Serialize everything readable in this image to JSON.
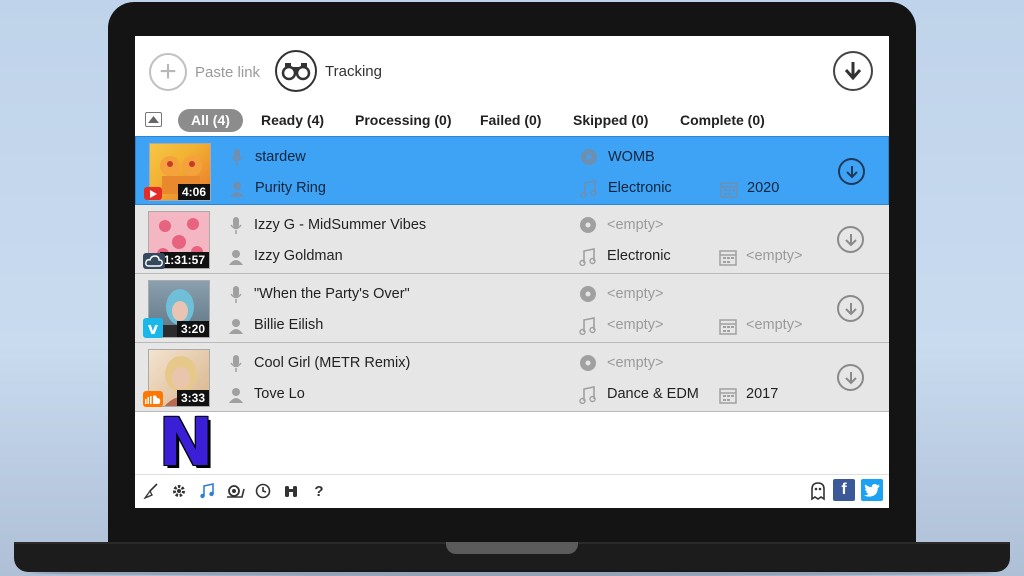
{
  "toolbar": {
    "paste_label": "Paste link",
    "tracking_label": "Tracking"
  },
  "tabs": [
    {
      "label": "All (4)",
      "active": true
    },
    {
      "label": "Ready (4)"
    },
    {
      "label": "Processing (0)"
    },
    {
      "label": "Failed (0)"
    },
    {
      "label": "Skipped (0)"
    },
    {
      "label": "Complete (0)"
    }
  ],
  "rows": [
    {
      "title": "stardew",
      "artist": "Purity Ring",
      "album": "WOMB",
      "genre": "Electronic",
      "year": "2020",
      "duration": "4:06",
      "source": "youtube-icon",
      "selected": true
    },
    {
      "title": "Izzy G - MidSummer Vibes",
      "artist": "Izzy Goldman",
      "album": "<empty>",
      "genre": "Electronic",
      "year": "<empty>",
      "duration": "1:31:57",
      "source": "cloud-icon"
    },
    {
      "title": "\"When the Party's Over\"",
      "artist": "Billie Eilish",
      "album": "<empty>",
      "genre": "<empty>",
      "year": "<empty>",
      "duration": "3:20",
      "source": "vimeo-icon"
    },
    {
      "title": "Cool Girl (METR Remix)",
      "artist": "Tove Lo",
      "album": "<empty>",
      "genre": "Dance & EDM",
      "year": "2017",
      "duration": "3:33",
      "source": "soundcloud-icon"
    }
  ],
  "logo_text": "N",
  "colors": {
    "selected_row": "#3ea2f5",
    "row_bg": "#e6e6e6",
    "youtube": "#e52d27",
    "vimeo": "#1ab7ea",
    "soundcloud": "#ff7700",
    "facebook": "#3b5998",
    "twitter": "#1da1f2"
  }
}
